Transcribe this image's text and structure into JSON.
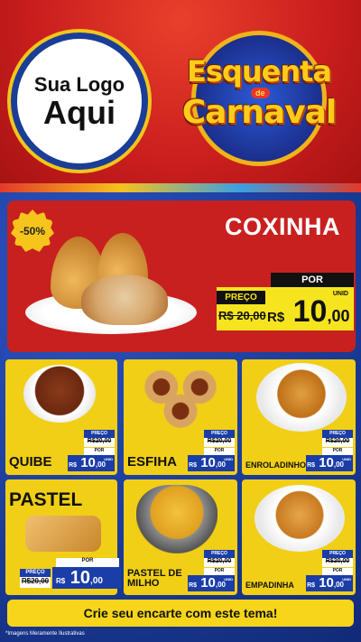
{
  "header": {
    "logo_line1": "Sua Logo",
    "logo_line2": "Aqui",
    "title_line1": "Esquenta",
    "title_de": "de",
    "title_line2": "Carnaval"
  },
  "featured": {
    "discount": "-50%",
    "name": "COXINHA",
    "por_label": "POR",
    "preco_label": "PREÇO",
    "old_price": "R$ 20,00",
    "currency": "R$",
    "price_int": "10",
    "price_cents": ",00",
    "unit": "UNID"
  },
  "products": [
    {
      "name": "QUIBE",
      "preco": "PREÇO",
      "old": "R$20,00",
      "por": "POR",
      "currency": "R$",
      "int": "10",
      "cents": ",00",
      "unit": "UNID"
    },
    {
      "name": "ESFIHA",
      "preco": "PREÇO",
      "old": "R$20,00",
      "por": "POR",
      "currency": "R$",
      "int": "10",
      "cents": ",00",
      "unit": "UNID"
    },
    {
      "name": "ENROLADINHO",
      "preco": "PREÇO",
      "old": "R$20,00",
      "por": "POR",
      "currency": "R$",
      "int": "10",
      "cents": ",00",
      "unit": "UNID"
    },
    {
      "name": "PASTEL",
      "preco": "PREÇO",
      "old": "R$20,00",
      "por": "POR",
      "currency": "R$",
      "int": "10",
      "cents": ",00",
      "unit": "UNID"
    },
    {
      "name": "PASTEL DE MILHO",
      "preco": "PREÇO",
      "old": "R$20,00",
      "por": "POR",
      "currency": "R$",
      "int": "10",
      "cents": ",00",
      "unit": "UNID"
    },
    {
      "name": "EMPADINHA",
      "preco": "PREÇO",
      "old": "R$20,00",
      "por": "POR",
      "currency": "R$",
      "int": "10",
      "cents": ",00",
      "unit": "UNID"
    }
  ],
  "footer": {
    "cta": "Crie seu encarte com este tema!",
    "disclaimer": "*Imagens Meramente Ilustrativas"
  },
  "colors": {
    "red": "#c8201f",
    "yellow": "#f1cf17",
    "blue": "#1a3da8"
  }
}
